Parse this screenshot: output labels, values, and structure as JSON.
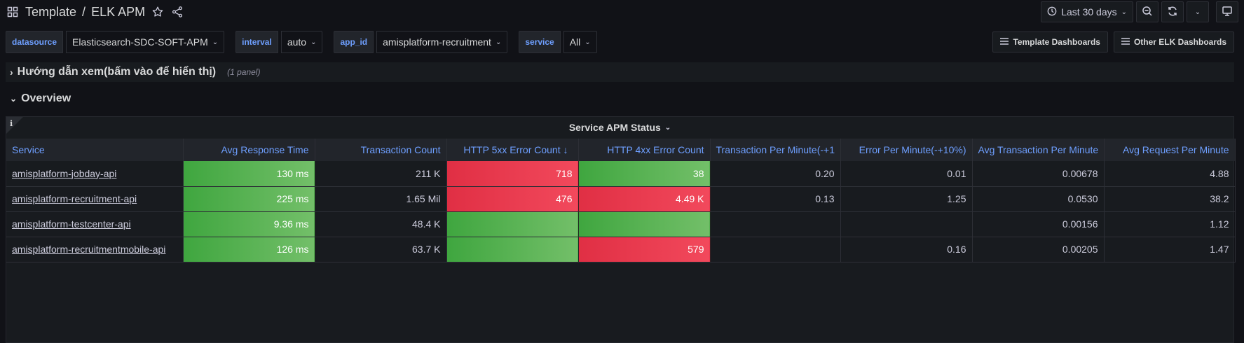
{
  "header": {
    "breadcrumb_folder": "Template",
    "breadcrumb_sep": "/",
    "dashboard_title": "ELK APM",
    "time_range": "Last 30 days"
  },
  "variables": [
    {
      "label": "datasource",
      "value": "Elasticsearch-SDC-SOFT-APM"
    },
    {
      "label": "interval",
      "value": "auto"
    },
    {
      "label": "app_id",
      "value": "amisplatform-recruitment"
    },
    {
      "label": "service",
      "value": "All"
    }
  ],
  "links": [
    "Template Dashboards",
    "Other ELK Dashboards"
  ],
  "rows": {
    "guide": {
      "title": "Hướng dẫn xem(bấm vào để hiển thị)",
      "count": "(1 panel)"
    },
    "overview": {
      "title": "Overview"
    }
  },
  "panel": {
    "info_glyph": "i",
    "title": "Service APM Status",
    "columns": [
      "Service",
      "Avg Response Time",
      "Transaction Count",
      "HTTP 5xx Error Count",
      "HTTP 4xx Error Count",
      "Transaction Per Minute(-+1",
      "Error Per Minute(-+10%)",
      "Avg Transaction Per Minute",
      "Avg Request Per Minute"
    ],
    "sort_indicator": "↓",
    "rows": [
      {
        "service": "amisplatform-jobday-api",
        "avg_response": "130 ms",
        "tx_count": "211 K",
        "http5xx": "718",
        "http4xx": "38",
        "tpm": "0.20",
        "epm": "0.01",
        "avg_tpm": "0.00678",
        "avg_rpm": "4.88"
      },
      {
        "service": "amisplatform-recruitment-api",
        "avg_response": "225 ms",
        "tx_count": "1.65 Mil",
        "http5xx": "476",
        "http4xx": "4.49 K",
        "tpm": "0.13",
        "epm": "1.25",
        "avg_tpm": "0.0530",
        "avg_rpm": "38.2"
      },
      {
        "service": "amisplatform-testcenter-api",
        "avg_response": "9.36 ms",
        "tx_count": "48.4 K",
        "http5xx": "",
        "http4xx": "",
        "tpm": "",
        "epm": "",
        "avg_tpm": "0.00156",
        "avg_rpm": "1.12"
      },
      {
        "service": "amisplatform-recruitmentmobile-api",
        "avg_response": "126 ms",
        "tx_count": "63.7 K",
        "http5xx": "",
        "http4xx": "579",
        "tpm": "",
        "epm": "0.16",
        "avg_tpm": "0.00205",
        "avg_rpm": "1.47"
      }
    ]
  },
  "colors": {
    "background": "#111217",
    "panel": "#181b1f",
    "accent_blue": "#6e9fff",
    "ok_green": "#73bf69",
    "error_red": "#f2495c"
  }
}
